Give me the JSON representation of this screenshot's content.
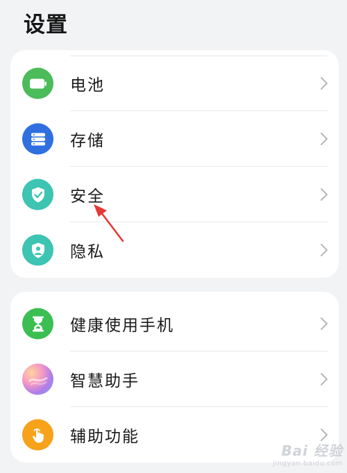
{
  "page": {
    "title": "设置"
  },
  "groups": [
    {
      "items": [
        {
          "label": "电池",
          "icon": "battery-icon",
          "icon_color": "#4cbb5a"
        },
        {
          "label": "存储",
          "icon": "storage-icon",
          "icon_color": "#2f6fe0"
        },
        {
          "label": "安全",
          "icon": "shield-check-icon",
          "icon_color": "#3dc4b2"
        },
        {
          "label": "隐私",
          "icon": "privacy-shield-icon",
          "icon_color": "#3dc4b2"
        }
      ]
    },
    {
      "items": [
        {
          "label": "健康使用手机",
          "icon": "hourglass-icon",
          "icon_color": "#3cbf52"
        },
        {
          "label": "智慧助手",
          "icon": "smart-assistant-icon",
          "icon_color": "#c77ae0"
        },
        {
          "label": "辅助功能",
          "icon": "hand-pointer-icon",
          "icon_color": "#f6a21b"
        }
      ]
    }
  ],
  "annotation": {
    "color": "#e53935"
  },
  "watermark": {
    "main": "Bai 经验",
    "sub": "jingyan.baidu.com"
  }
}
